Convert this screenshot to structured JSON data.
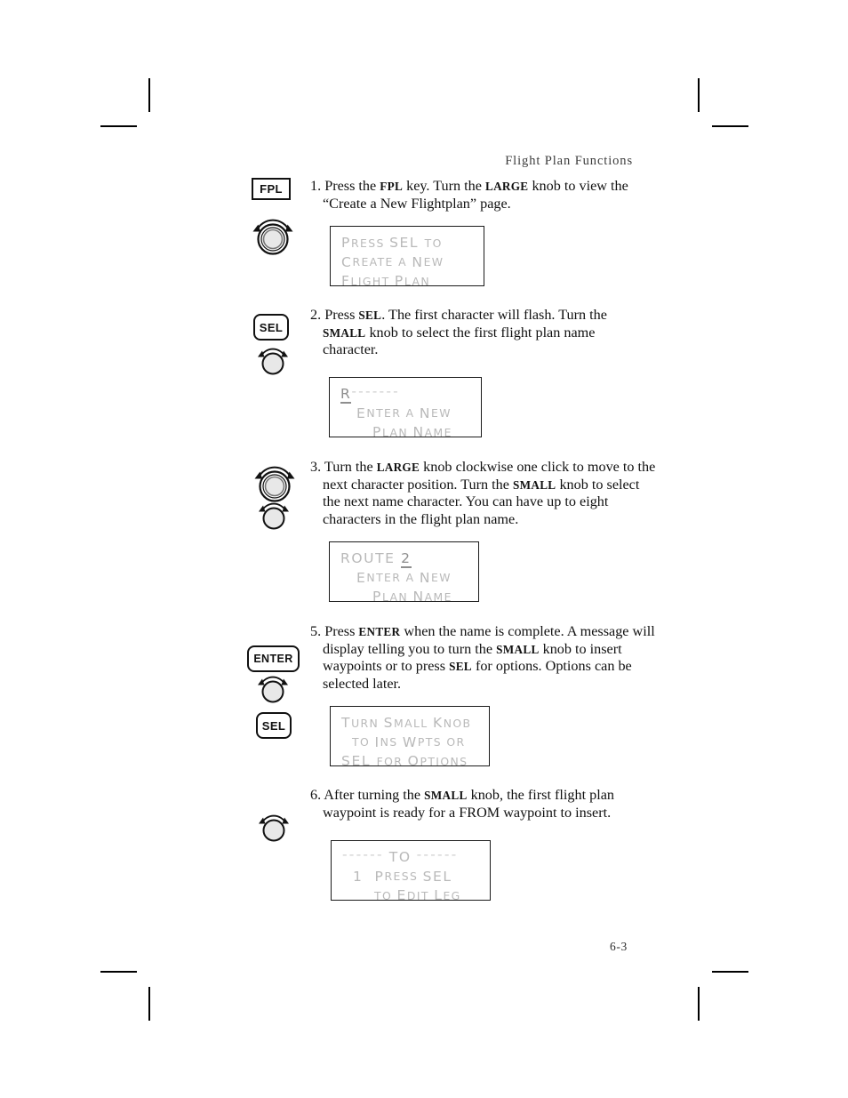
{
  "page": {
    "header": "Flight Plan Functions",
    "folio": "6-3"
  },
  "steps": [
    {
      "number": "1.",
      "text_parts": [
        {
          "t": "Press the ",
          "style": "normal"
        },
        {
          "t": "FPL",
          "style": "smallcaps"
        },
        {
          "t": " key. Turn the ",
          "style": "normal"
        },
        {
          "t": "LARGE",
          "style": "smallcaps"
        },
        {
          "t": " knob to view the “Create a New Flightplan” page.",
          "style": "normal"
        }
      ],
      "controls": [
        {
          "kind": "key-rect",
          "label": "FPL"
        },
        {
          "kind": "knob-large"
        }
      ],
      "lcd": {
        "lines": [
          [
            {
              "t": "P",
              "case": "up"
            },
            {
              "t": "RESS ",
              "case": "sm"
            },
            {
              "t": "SEL ",
              "case": "up"
            },
            {
              "t": "TO",
              "case": "sm"
            }
          ],
          [
            {
              "t": "C",
              "case": "up"
            },
            {
              "t": "REATE ",
              "case": "sm"
            },
            {
              "t": "A ",
              "case": "sm"
            },
            {
              "t": "N",
              "case": "up"
            },
            {
              "t": "EW",
              "case": "sm"
            }
          ],
          [
            {
              "t": "F",
              "case": "up"
            },
            {
              "t": "LIGHT ",
              "case": "sm"
            },
            {
              "t": "P",
              "case": "up"
            },
            {
              "t": "LAN",
              "case": "sm"
            }
          ]
        ],
        "plain": [
          "Press SEL to",
          "Create a New",
          "Flight Plan"
        ]
      }
    },
    {
      "number": "2.",
      "text_parts": [
        {
          "t": "Press ",
          "style": "normal"
        },
        {
          "t": "SEL",
          "style": "smallcaps"
        },
        {
          "t": ". The first character will flash. Turn the ",
          "style": "normal"
        },
        {
          "t": "SMALL",
          "style": "smallcaps"
        },
        {
          "t": " knob to select the first flight plan name character.",
          "style": "normal"
        }
      ],
      "controls": [
        {
          "kind": "key-round",
          "label": "SEL"
        },
        {
          "kind": "knob-small"
        }
      ],
      "lcd": {
        "cursor_char": "R",
        "dashes": "‐‐‐‐‐‐‐",
        "lines": [
          [
            {
              "t": "E",
              "case": "up"
            },
            {
              "t": "NTER ",
              "case": "sm"
            },
            {
              "t": "A ",
              "case": "sm"
            },
            {
              "t": "N",
              "case": "up"
            },
            {
              "t": "EW",
              "case": "sm"
            }
          ],
          [
            {
              "t": "P",
              "case": "up"
            },
            {
              "t": "LAN ",
              "case": "sm"
            },
            {
              "t": "N",
              "case": "up"
            },
            {
              "t": "AME",
              "case": "sm"
            }
          ]
        ],
        "plain": [
          "R‐‐‐‐‐‐‐",
          "Enter a New",
          "Plan Name"
        ]
      }
    },
    {
      "number": "3.",
      "text_parts": [
        {
          "t": "Turn the ",
          "style": "normal"
        },
        {
          "t": "LARGE",
          "style": "smallcaps"
        },
        {
          "t": " knob clockwise one click to move to the next character position. Turn the ",
          "style": "normal"
        },
        {
          "t": "SMALL",
          "style": "smallcaps"
        },
        {
          "t": " knob to select the next name character. You can have up to eight characters in the flight plan name.",
          "style": "normal"
        }
      ],
      "controls": [
        {
          "kind": "knob-large"
        },
        {
          "kind": "knob-small"
        }
      ],
      "lcd": {
        "name_value": "ROUTE ",
        "cursor_char": "2",
        "lines": [
          [
            {
              "t": "E",
              "case": "up"
            },
            {
              "t": "NTER ",
              "case": "sm"
            },
            {
              "t": "A ",
              "case": "sm"
            },
            {
              "t": "N",
              "case": "up"
            },
            {
              "t": "EW",
              "case": "sm"
            }
          ],
          [
            {
              "t": "P",
              "case": "up"
            },
            {
              "t": "LAN ",
              "case": "sm"
            },
            {
              "t": "N",
              "case": "up"
            },
            {
              "t": "AME",
              "case": "sm"
            }
          ]
        ],
        "plain": [
          "ROUTE 2",
          "Enter a New",
          "Plan Name"
        ]
      }
    },
    {
      "number": "5.",
      "text_parts": [
        {
          "t": "Press ",
          "style": "normal"
        },
        {
          "t": "ENTER",
          "style": "smallcaps"
        },
        {
          "t": " when the name is complete. A message will display telling you to turn the ",
          "style": "normal"
        },
        {
          "t": "SMALL",
          "style": "smallcaps"
        },
        {
          "t": " knob to insert waypoints or to press ",
          "style": "normal"
        },
        {
          "t": "SEL",
          "style": "smallcaps"
        },
        {
          "t": " for options. Options can be selected later.",
          "style": "normal"
        }
      ],
      "controls": [
        {
          "kind": "key-round",
          "label": "ENTER"
        },
        {
          "kind": "knob-small"
        },
        {
          "kind": "key-round",
          "label": "SEL"
        }
      ],
      "lcd": {
        "lines": [
          [
            {
              "t": "T",
              "case": "up"
            },
            {
              "t": "URN ",
              "case": "sm"
            },
            {
              "t": "S",
              "case": "up"
            },
            {
              "t": "MALL ",
              "case": "sm"
            },
            {
              "t": "K",
              "case": "up"
            },
            {
              "t": "NOB",
              "case": "sm"
            }
          ],
          [
            {
              "t": "TO ",
              "case": "sm"
            },
            {
              "t": "I",
              "case": "up"
            },
            {
              "t": "NS ",
              "case": "sm"
            },
            {
              "t": "W",
              "case": "up"
            },
            {
              "t": "PTS ",
              "case": "sm"
            },
            {
              "t": "OR",
              "case": "sm"
            }
          ],
          [
            {
              "t": "SEL ",
              "case": "up"
            },
            {
              "t": "FOR ",
              "case": "sm"
            },
            {
              "t": "O",
              "case": "up"
            },
            {
              "t": "PTIONS",
              "case": "sm"
            }
          ]
        ],
        "plain": [
          "Turn Small Knob",
          "to Ins Wpts or",
          "SEL for Options"
        ]
      }
    },
    {
      "number": "6.",
      "text_parts": [
        {
          "t": "After turning the ",
          "style": "normal"
        },
        {
          "t": "SMALL",
          "style": "smallcaps"
        },
        {
          "t": " knob, the first flight plan waypoint is ready for a FROM waypoint to insert.",
          "style": "normal"
        }
      ],
      "controls": [
        {
          "kind": "knob-small"
        }
      ],
      "lcd": {
        "dashes_left": "‐‐‐‐‐‐",
        "to_label": "TO",
        "dashes_right": "‐‐‐‐‐‐",
        "leg_number": "1",
        "lines": [
          [
            {
              "t": "P",
              "case": "up"
            },
            {
              "t": "RESS ",
              "case": "sm"
            },
            {
              "t": "SEL",
              "case": "up"
            }
          ],
          [
            {
              "t": "TO ",
              "case": "sm"
            },
            {
              "t": "E",
              "case": "up"
            },
            {
              "t": "DIT ",
              "case": "sm"
            },
            {
              "t": "L",
              "case": "up"
            },
            {
              "t": "EG",
              "case": "sm"
            }
          ]
        ],
        "plain": [
          "‐‐‐‐‐‐ TO ‐‐‐‐‐‐",
          "1  Press SEL",
          "to Edit Leg"
        ]
      }
    }
  ],
  "icons": {
    "knob_large": "large-knob-icon",
    "knob_small": "small-knob-icon"
  },
  "colors": {
    "ink": "#111111",
    "lcd_text": "#b9b9b9",
    "lcd_cursor": "#8e8e8e",
    "header_gray": "#3b3b3b"
  }
}
